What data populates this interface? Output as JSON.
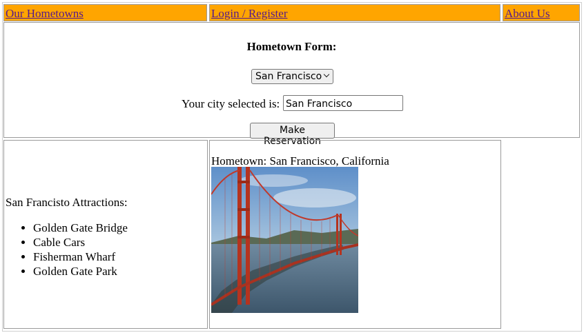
{
  "nav": {
    "items": [
      {
        "label": "Our Hometowns"
      },
      {
        "label": "Login / Register"
      },
      {
        "label": "About Us"
      }
    ]
  },
  "form": {
    "title": "Hometown Form:",
    "select_value": "San Francisco",
    "city_label": "Your city selected is:",
    "city_value": "San Francisco",
    "button_label": "Make Reservation"
  },
  "attractions": {
    "title": "San Francisto Attractions:",
    "items": [
      "Golden Gate Bridge",
      "Cable Cars",
      "Fisherman Wharf",
      "Golden Gate Park"
    ]
  },
  "hometown": {
    "label": "Hometown: San Francisco, California",
    "image_icon": "golden-gate-bridge-photo"
  },
  "colors": {
    "nav_background": "#ffa500",
    "link": "#551a8b",
    "bridge": "#c0392b"
  }
}
